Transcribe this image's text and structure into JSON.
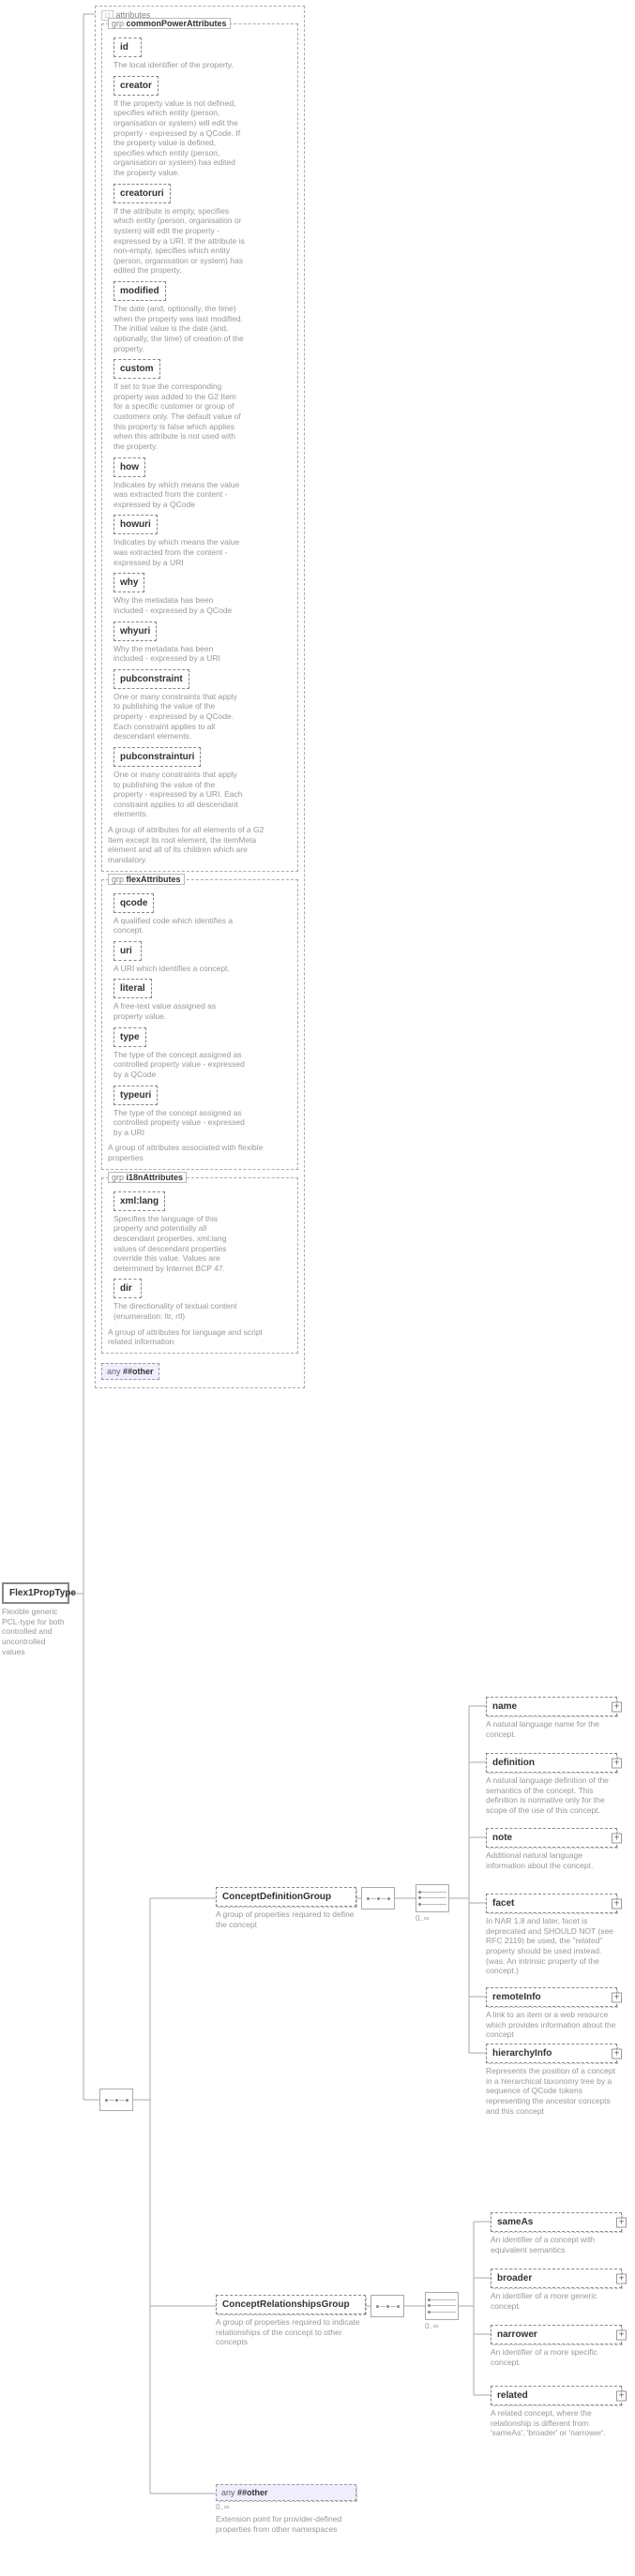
{
  "root": {
    "name": "Flex1PropType",
    "desc": "Flexible generic PCL-type for both controlled and uncontrolled values"
  },
  "attrs_label": "attributes",
  "grp1": {
    "tag": "grp",
    "name": "commonPowerAttributes",
    "items": [
      {
        "name": "id",
        "desc": "The local identifier of the property."
      },
      {
        "name": "creator",
        "desc": "If the property value is not defined, specifies which entity (person, organisation or system) will edit the property - expressed by a QCode. If the property value is defined, specifies which entity (person, organisation or system) has edited the property value."
      },
      {
        "name": "creatoruri",
        "desc": "If the attribute is empty, specifies which entity (person, organisation or system) will edit the property - expressed by a URI. If the attribute is non-empty, specifies which entity (person, organisation or system) has edited the property."
      },
      {
        "name": "modified",
        "desc": "The date (and, optionally, the time) when the property was last modified. The initial value is the date (and, optionally, the time) of creation of the property."
      },
      {
        "name": "custom",
        "desc": "If set to true the corresponding property was added to the G2 Item for a specific customer or group of customers only. The default value of this property is false which applies when this attribute is not used with the property."
      },
      {
        "name": "how",
        "desc": "Indicates by which means the value was extracted from the content - expressed by a QCode"
      },
      {
        "name": "howuri",
        "desc": "Indicates by which means the value was extracted from the content - expressed by a URI"
      },
      {
        "name": "why",
        "desc": "Why the metadata has been included - expressed by a QCode"
      },
      {
        "name": "whyuri",
        "desc": "Why the metadata has been included - expressed by a URI"
      },
      {
        "name": "pubconstraint",
        "desc": "One or many constraints that apply to publishing the value of the property - expressed by a QCode. Each constraint applies to all descendant elements."
      },
      {
        "name": "pubconstrainturi",
        "desc": "One or many constraints that apply to publishing the value of the property - expressed by a URI. Each constraint applies to all descendant elements."
      }
    ],
    "groupdesc": "A group of attributes for all elements of a G2 Item except its root element, the itemMeta element and all of its children which are mandatory."
  },
  "grp2": {
    "tag": "grp",
    "name": "flexAttributes",
    "items": [
      {
        "name": "qcode",
        "desc": "A qualified code which identifies a concept."
      },
      {
        "name": "uri",
        "desc": "A URI which identifies a concept."
      },
      {
        "name": "literal",
        "desc": "A free-text value assigned as property value."
      },
      {
        "name": "type",
        "desc": "The type of the concept assigned as controlled property value - expressed by a QCode"
      },
      {
        "name": "typeuri",
        "desc": "The type of the concept assigned as controlled property value - expressed by a URI"
      }
    ],
    "groupdesc": "A group of attributes associated with flexible properties"
  },
  "grp3": {
    "tag": "grp",
    "name": "i18nAttributes",
    "items": [
      {
        "name": "xml:lang",
        "desc": "Specifies the language of this property and potentially all descendant properties. xml:lang values of descendant properties override this value. Values are determined by Internet BCP 47."
      },
      {
        "name": "dir",
        "desc": "The directionality of textual content (enumeration: ltr, rtl)"
      }
    ],
    "groupdesc": "A group of attributes for language and script related information"
  },
  "any_label": "any",
  "any_ns": "##other",
  "cdg": {
    "name": "ConceptDefinitionGroup",
    "desc": "A group of properties required to define the concept",
    "items": [
      {
        "name": "name",
        "desc": "A natural language name for the concept."
      },
      {
        "name": "definition",
        "desc": "A natural language definition of the semantics of the concept. This definition is normative only for the scope of the use of this concept."
      },
      {
        "name": "note",
        "desc": "Additional natural language information about the concept."
      },
      {
        "name": "facet",
        "desc": "In NAR 1.8 and later, facet is deprecated and SHOULD NOT (see RFC 2119) be used, the \"related\" property should be used instead. (was: An intrinsic property of the concept.)"
      },
      {
        "name": "remoteInfo",
        "desc": "A link to an item or a web resource which provides information about the concept"
      },
      {
        "name": "hierarchyInfo",
        "desc": "Represents the position of a concept in a hierarchical taxonomy tree by a sequence of QCode tokens representing the ancestor concepts and this concept"
      }
    ]
  },
  "crg": {
    "name": "ConceptRelationshipsGroup",
    "desc": "A group of properties required to indicate relationships of the concept to other concepts",
    "items": [
      {
        "name": "sameAs",
        "desc": "An identifier of a concept with equivalent semantics"
      },
      {
        "name": "broader",
        "desc": "An identifier of a more generic concept."
      },
      {
        "name": "narrower",
        "desc": "An identifier of a more specific concept."
      },
      {
        "name": "related",
        "desc": "A related concept, where the relationship is different from 'sameAs', 'broader' or 'narrower'."
      }
    ]
  },
  "ext": {
    "label": "any",
    "ns": "##other",
    "desc": "Extension point for provider-defined properties from other namespaces"
  },
  "card_inf": "0..∞"
}
